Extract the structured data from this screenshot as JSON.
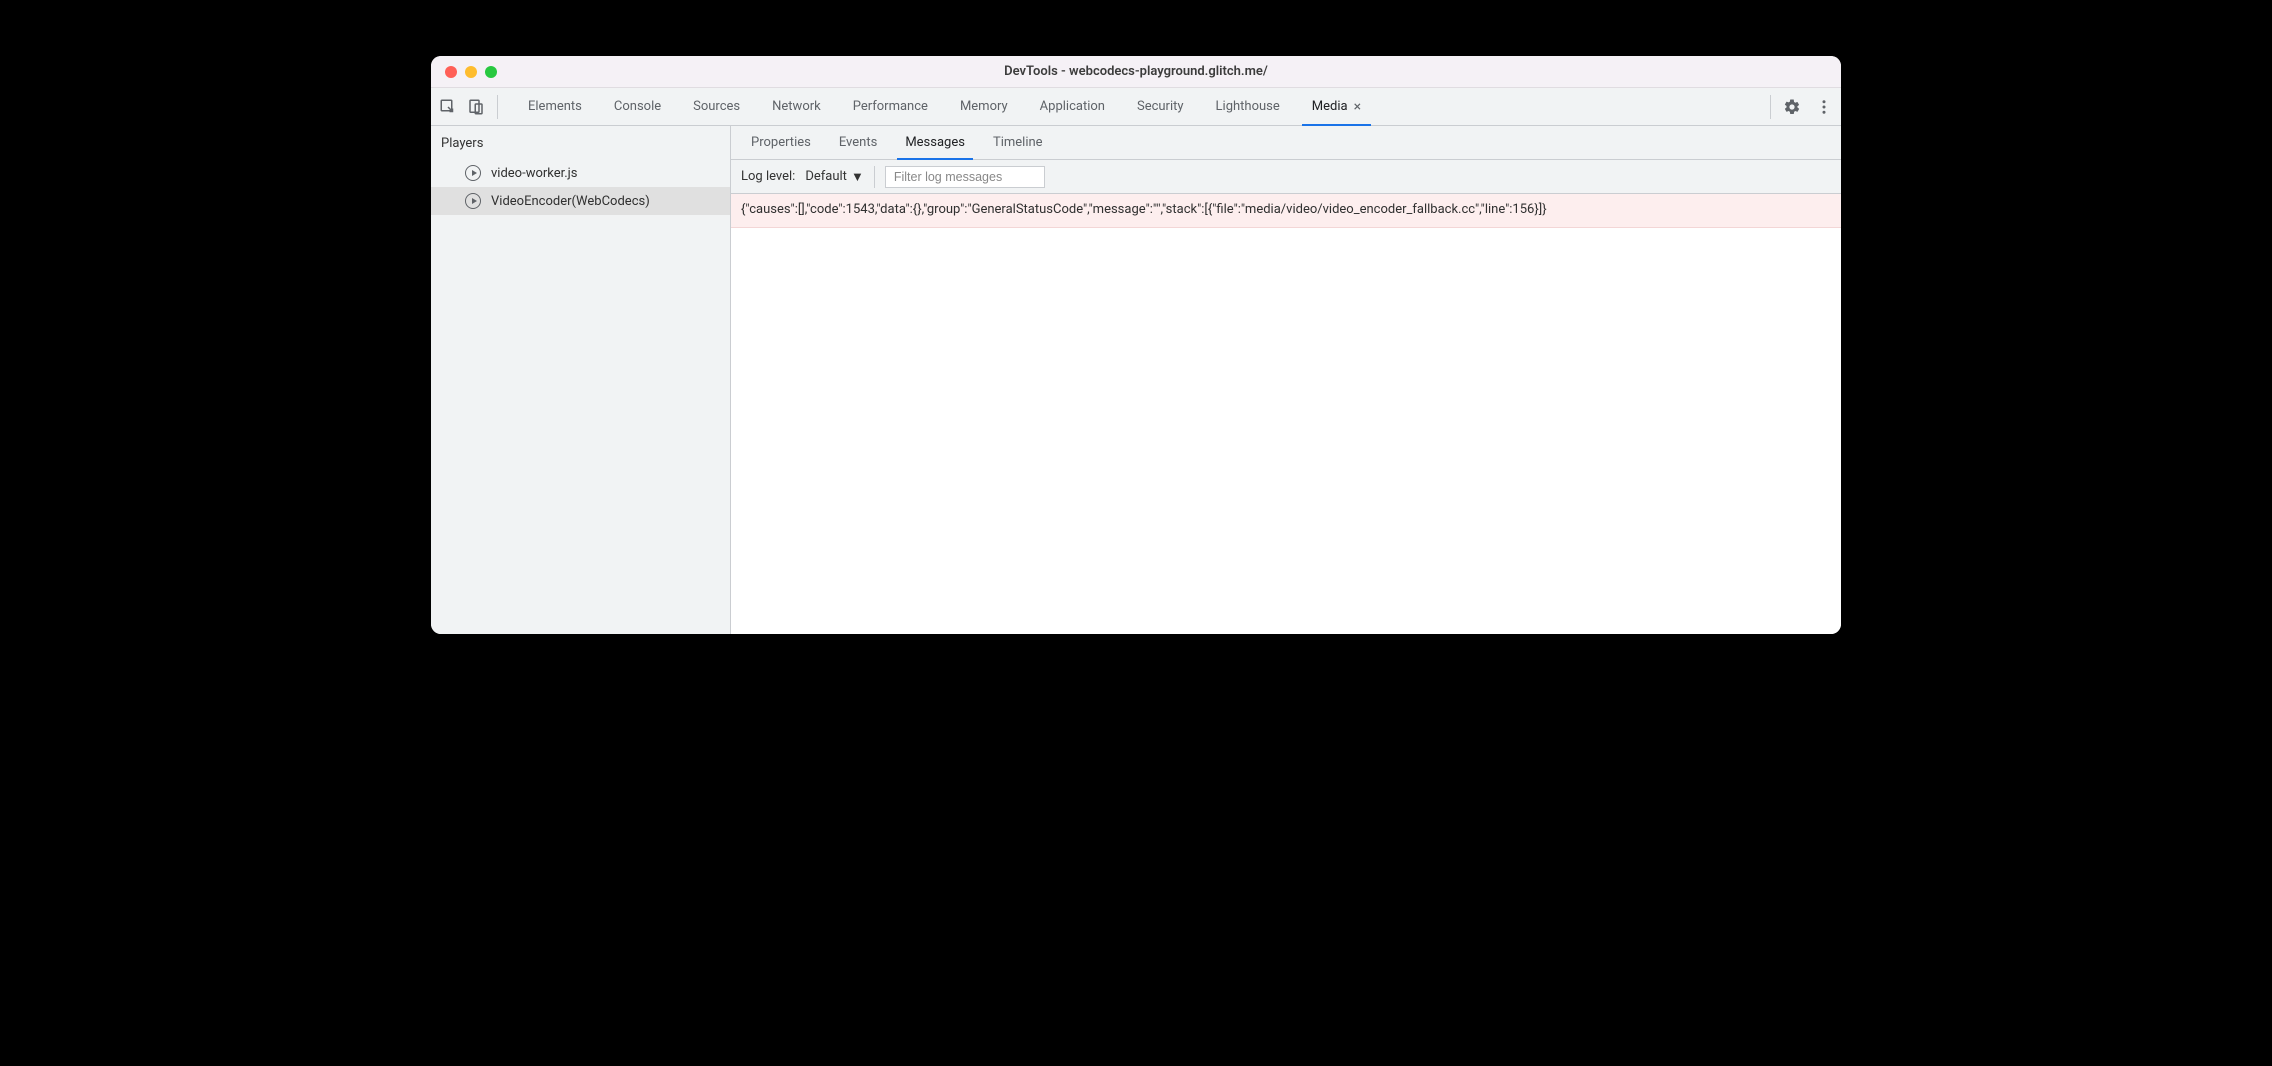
{
  "window": {
    "title": "DevTools - webcodecs-playground.glitch.me/"
  },
  "mainTabs": {
    "items": [
      {
        "label": "Elements"
      },
      {
        "label": "Console"
      },
      {
        "label": "Sources"
      },
      {
        "label": "Network"
      },
      {
        "label": "Performance"
      },
      {
        "label": "Memory"
      },
      {
        "label": "Application"
      },
      {
        "label": "Security"
      },
      {
        "label": "Lighthouse"
      },
      {
        "label": "Media"
      }
    ]
  },
  "sidebar": {
    "header": "Players",
    "players": [
      {
        "label": "video-worker.js"
      },
      {
        "label": "VideoEncoder(WebCodecs)"
      }
    ]
  },
  "subTabs": {
    "items": [
      {
        "label": "Properties"
      },
      {
        "label": "Events"
      },
      {
        "label": "Messages"
      },
      {
        "label": "Timeline"
      }
    ]
  },
  "filterBar": {
    "logLevelLabel": "Log level:",
    "logLevelValue": "Default",
    "filterPlaceholder": "Filter log messages"
  },
  "messages": {
    "row0": "{\"causes\":[],\"code\":1543,\"data\":{},\"group\":\"GeneralStatusCode\",\"message\":\"\",\"stack\":[{\"file\":\"media/video/video_encoder_fallback.cc\",\"line\":156}]}"
  }
}
